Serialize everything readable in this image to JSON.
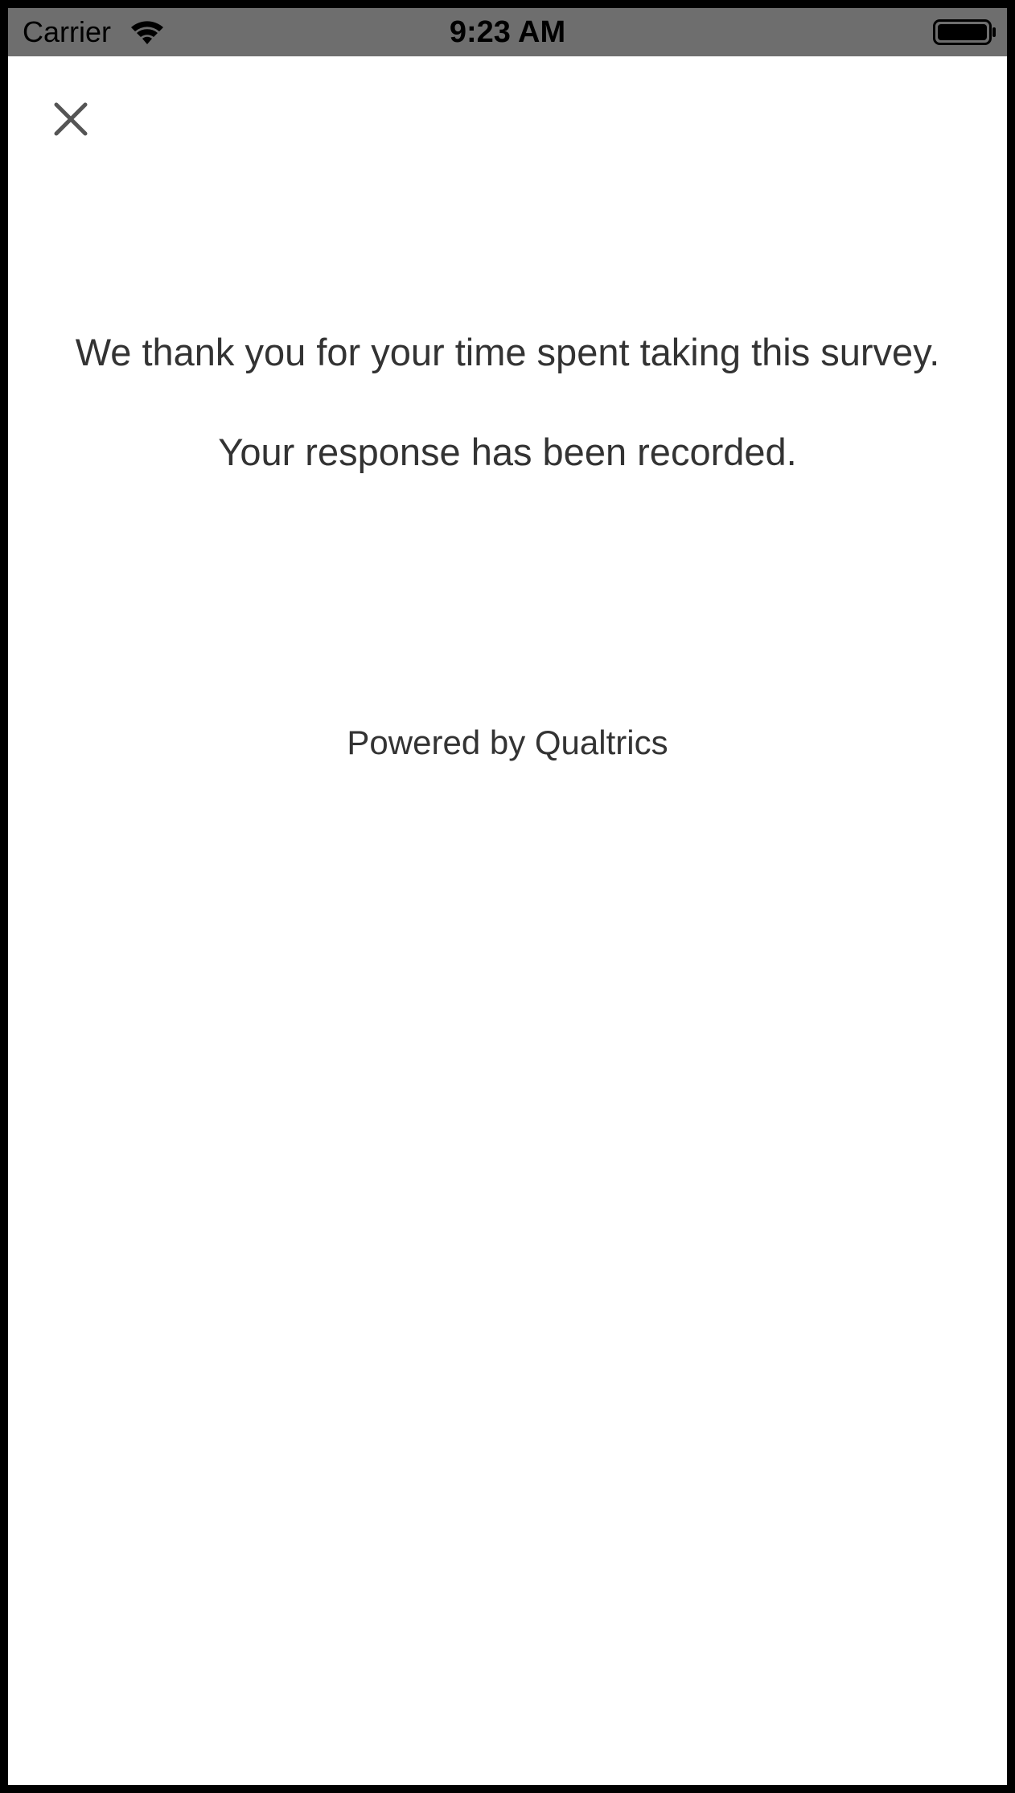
{
  "status_bar": {
    "carrier": "Carrier",
    "time": "9:23 AM",
    "background_color": "#6e6e6e",
    "wifi_icon": "wifi-icon",
    "battery_icon": "battery-full-icon"
  },
  "header": {
    "close_icon": "close-icon"
  },
  "content": {
    "thank_you_text": "We thank you for your time spent taking this survey.",
    "recorded_text": "Your response has been recorded.",
    "powered_by": "Powered by Qualtrics",
    "text_color": "#333333"
  }
}
